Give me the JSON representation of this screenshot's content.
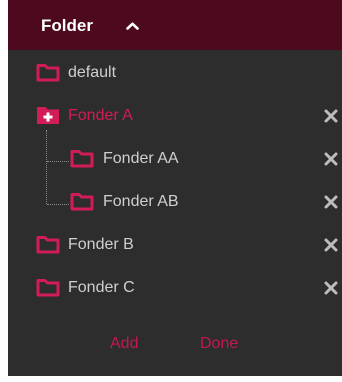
{
  "header": {
    "title": "Folder",
    "toggle_icon": "chevron-up-icon"
  },
  "colors": {
    "header_bg": "#4d0a1e",
    "panel_bg": "#2d2d2d",
    "accent": "#d11c56",
    "text": "#cfcfcf",
    "close_icon": "#bdbdbd"
  },
  "folders": [
    {
      "label": "default",
      "icon": "folder-icon",
      "active": false,
      "removable": false,
      "level": 0
    },
    {
      "label": "Fonder A",
      "icon": "folder-plus-icon",
      "active": true,
      "removable": true,
      "level": 0
    },
    {
      "label": "Fonder AA",
      "icon": "folder-icon",
      "active": false,
      "removable": true,
      "level": 1
    },
    {
      "label": "Fonder AB",
      "icon": "folder-icon",
      "active": false,
      "removable": true,
      "level": 1
    },
    {
      "label": "Fonder B",
      "icon": "folder-icon",
      "active": false,
      "removable": true,
      "level": 0
    },
    {
      "label": "Fonder C",
      "icon": "folder-icon",
      "active": false,
      "removable": true,
      "level": 0
    }
  ],
  "actions": {
    "add_label": "Add",
    "done_label": "Done"
  }
}
